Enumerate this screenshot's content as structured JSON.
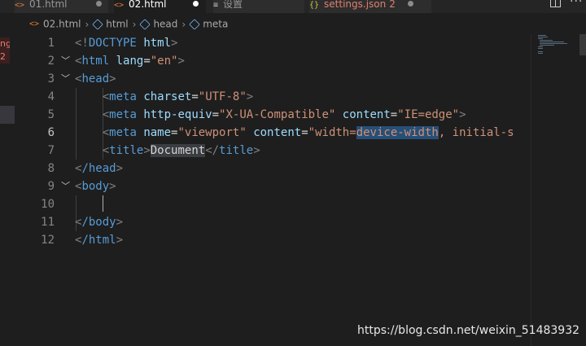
{
  "tabs": [
    {
      "label": "01.html",
      "icon": "html-file-icon",
      "modified": true,
      "active": false
    },
    {
      "label": "02.html",
      "icon": "html-file-icon",
      "modified": true,
      "active": true
    },
    {
      "label": "设置",
      "icon": "settings-editor-icon",
      "active": false
    },
    {
      "label": "settings.json",
      "icon": "json-file-icon",
      "problems": "2",
      "modified": true,
      "active": false
    }
  ],
  "breadcrumb": {
    "file": "02.html",
    "items": [
      "html",
      "head",
      "meta"
    ]
  },
  "activity": {
    "badge_text": "ng\n2"
  },
  "editor": {
    "active_line": "6",
    "line_numbers": [
      "1",
      "2",
      "3",
      "4",
      "5",
      "6",
      "7",
      "8",
      "9",
      "10",
      "11",
      "12"
    ],
    "lines": {
      "l1_open": "<!",
      "l1_doctype": "DOCTYPE",
      "l1_html": "html",
      "l1_close": ">",
      "l2_lt": "<",
      "l2_tag": "html",
      "l2_attr": "lang",
      "l2_eq": "=",
      "l2_val": "\"en\"",
      "l2_gt": ">",
      "l3_tag": "head",
      "l4_tag": "meta",
      "l4_attr": "charset",
      "l4_val": "\"UTF-8\"",
      "l5_tag": "meta",
      "l5_attr1": "http-equiv",
      "l5_val1": "\"X-UA-Compatible\"",
      "l5_attr2": "content",
      "l5_val2": "\"IE=edge\"",
      "l6_tag": "meta",
      "l6_attr1": "name",
      "l6_val1": "\"viewport\"",
      "l6_attr2": "content",
      "l6_val2a": "\"width=",
      "l6_val2_sel": "device-width",
      "l6_val2b": ", initial-s",
      "l7_tag": "title",
      "l7_text": "Document",
      "l8_tag": "/head",
      "l9_tag": "body",
      "l11_tag": "/body",
      "l12_tag": "/html"
    }
  },
  "watermark": "https://blog.csdn.net/weixin_51483932",
  "colors": {
    "background": "#1e1e1e",
    "tag": "#569cd6",
    "attribute": "#9cdcfe",
    "string": "#ce9178",
    "selection": "#264f78"
  }
}
